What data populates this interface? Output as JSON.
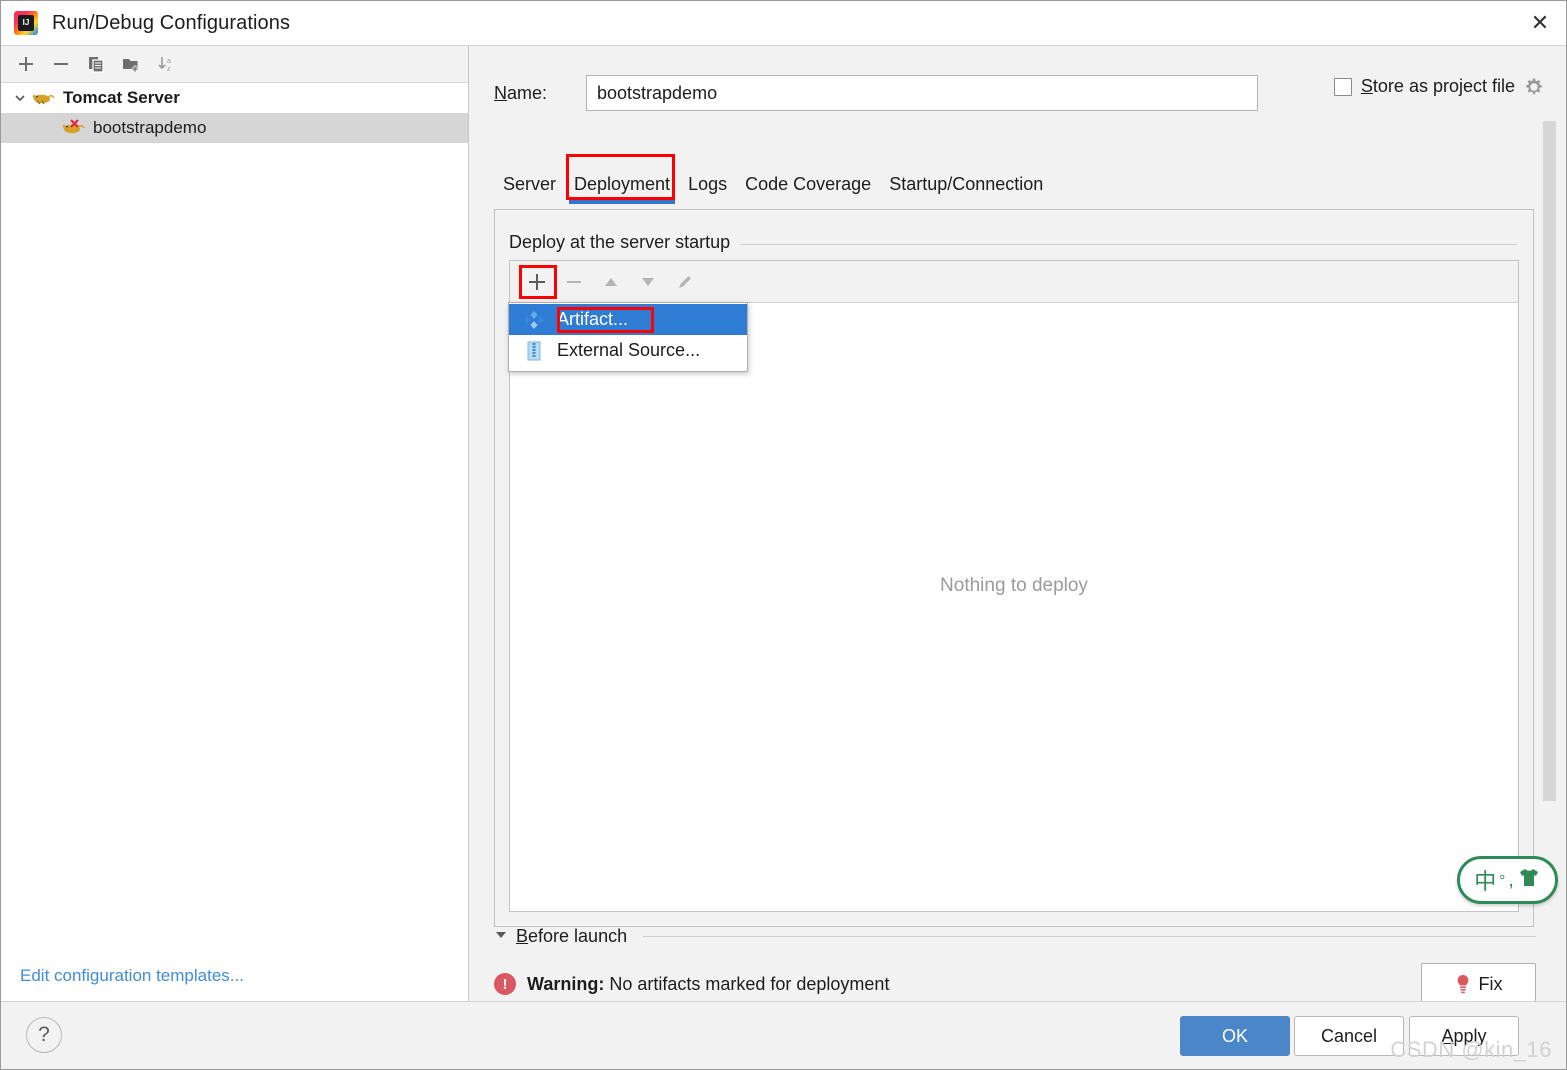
{
  "window": {
    "title": "Run/Debug Configurations",
    "app_icon": "intellij-idea-logo",
    "close_label": "✕"
  },
  "left_panel": {
    "toolbar": [
      {
        "name": "add-configuration-button",
        "icon": "plus-icon",
        "label": "+"
      },
      {
        "name": "remove-configuration-button",
        "icon": "minus-icon",
        "label": "−"
      },
      {
        "name": "copy-configuration-button",
        "icon": "copy-icon",
        "label": "Copy"
      },
      {
        "name": "add-folder-button",
        "icon": "new-folder-icon",
        "label": "New Folder"
      },
      {
        "name": "sort-configurations-button",
        "icon": "sort-alphabetical-icon",
        "label": "Sort"
      }
    ],
    "tree": [
      {
        "label": "Tomcat Server",
        "icon": "tomcat-icon",
        "expanded": true,
        "selected": false
      },
      {
        "label": "bootstrapdemo",
        "icon": "tomcat-error-icon",
        "expanded": false,
        "selected": true
      }
    ],
    "edit_templates_link": "Edit configuration templates..."
  },
  "form": {
    "name_label": "Name:",
    "name_value": "bootstrapdemo",
    "name_placeholder": "",
    "store_as_project_file_label": "Store as project file",
    "store_as_project_file_checked": false,
    "gear_icon": "gear-icon"
  },
  "tabs": [
    {
      "label": "Server",
      "active": false
    },
    {
      "label": "Deployment",
      "active": true,
      "annotated": true
    },
    {
      "label": "Logs",
      "active": false
    },
    {
      "label": "Code Coverage",
      "active": false
    },
    {
      "label": "Startup/Connection",
      "active": false
    }
  ],
  "deployment": {
    "group_caption": "Deploy at the server startup",
    "toolbar": [
      {
        "name": "add-artifact-button",
        "icon": "plus-icon",
        "label": "+",
        "enabled": true,
        "annotated": true
      },
      {
        "name": "remove-artifact-button",
        "icon": "minus-icon",
        "label": "−",
        "enabled": false
      },
      {
        "name": "move-up-button",
        "icon": "arrow-up-icon",
        "label": "▲",
        "enabled": false
      },
      {
        "name": "move-down-button",
        "icon": "arrow-down-icon",
        "label": "▼",
        "enabled": false
      },
      {
        "name": "edit-artifact-button",
        "icon": "pencil-icon",
        "label": "✎",
        "enabled": false
      }
    ],
    "empty_text": "Nothing to deploy",
    "popup_menu": [
      {
        "label": "Artifact...",
        "icon": "artifact-diamonds-icon",
        "selected": true,
        "annotated": true
      },
      {
        "label": "External Source...",
        "icon": "archive-zip-icon",
        "selected": false
      }
    ]
  },
  "before_launch": {
    "section_label": "Before launch",
    "expanded": true,
    "warning_prefix": "Warning:",
    "warning_message": "No artifacts marked for deployment",
    "warning_icon": "error-circle-icon",
    "fix_button_label": "Fix",
    "fix_button_icon": "bulb-icon"
  },
  "footer": {
    "help_label": "?",
    "ok_label": "OK",
    "cancel_label": "Cancel",
    "apply_label": "Apply"
  },
  "overlay": {
    "ime_widget": {
      "mode": "中",
      "degree": "°",
      "comma": ",",
      "skin_icon": "tshirt-icon"
    },
    "watermark": "CSDN @kin_16"
  },
  "colors": {
    "accent_blue": "#3573cc",
    "selection_blue": "#2f7cd4",
    "annotation_red": "#ff0000",
    "link_blue": "#3f8ddc",
    "warning_red": "#db5860",
    "ime_green": "#2e8b57"
  }
}
